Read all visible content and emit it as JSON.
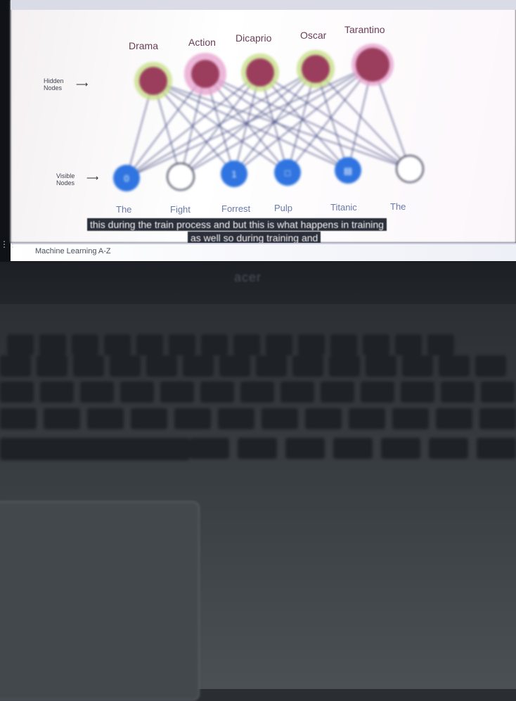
{
  "slide": {
    "hidden_nodes_label": "Hidden\nNodes",
    "visible_nodes_label": "Visible\nNodes",
    "hidden_nodes": [
      "Drama",
      "Action",
      "Dicaprio",
      "Oscar",
      "Tarantino"
    ],
    "visible_nodes": [
      {
        "label": "The",
        "value": "0",
        "state": "filled"
      },
      {
        "label": "Fight",
        "value": "",
        "state": "empty"
      },
      {
        "label": "Forrest",
        "value": "1",
        "state": "filled"
      },
      {
        "label": "Pulp",
        "value": "□",
        "state": "filled"
      },
      {
        "label": "Titanic",
        "value": "▤",
        "state": "filled"
      },
      {
        "label": "The",
        "value": "",
        "state": "empty"
      }
    ],
    "colors": {
      "hidden": "#9b3d5c",
      "visible": "#2f74e0",
      "edge": "#4a4f86"
    }
  },
  "captions": {
    "line1": "this during the train process and but this is what happens in training",
    "line2": "as well so during training and"
  },
  "statusbar": {
    "title": "Machine Learning A-Z"
  },
  "laptop": {
    "brand": "acer"
  }
}
